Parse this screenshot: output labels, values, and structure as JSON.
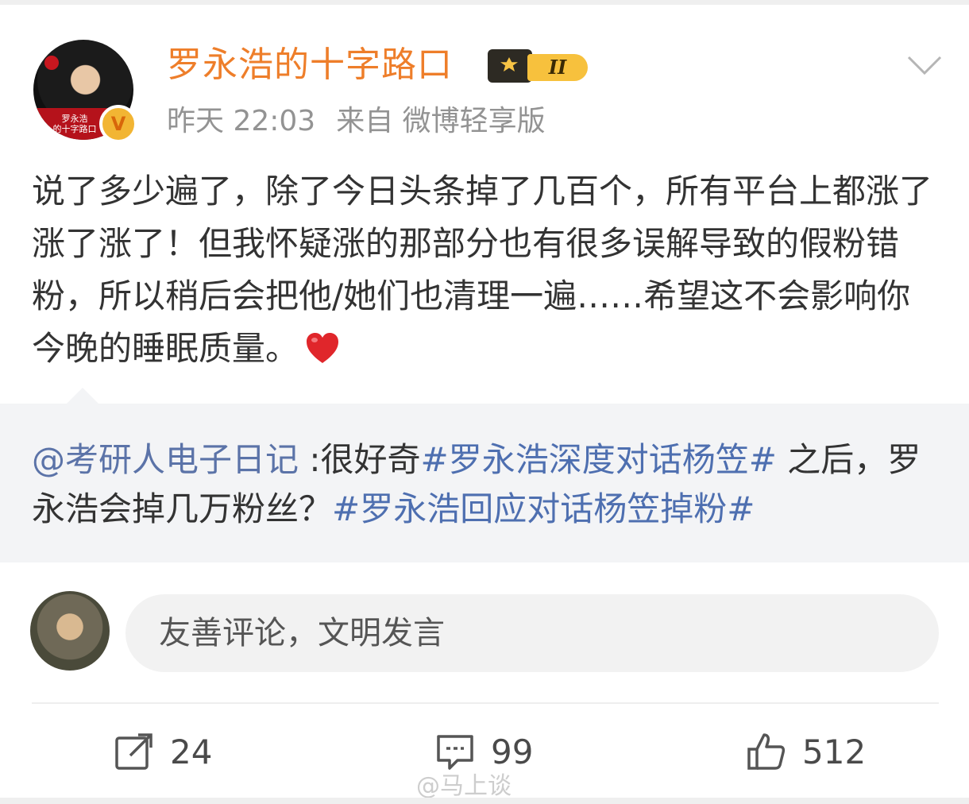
{
  "post": {
    "author": {
      "name": "罗永浩的十字路口",
      "avatar_caption": "罗永浩\n的十字路口",
      "verified_mark": "V",
      "member_level": "II"
    },
    "time": "昨天 22:03",
    "source": "来自 微博轻享版",
    "text": "说了多少遍了，除了今日头条掉了几百个，所有平台上都涨了涨了涨了！但我怀疑涨的那部分也有很多误解导致的假粉错粉，所以稍后会把他/她们也清理一遍……希望这不会影响你今晚的睡眠质量。",
    "quote": {
      "mention": "@考研人电子日记",
      "text_before": " :很好奇",
      "hashtag1": "#罗永浩深度对话杨笠#",
      "text_middle": " 之后，罗永浩会掉几万粉丝？",
      "hashtag2": "#罗永浩回应对话杨笠掉粉#"
    }
  },
  "comment_box": {
    "placeholder": "友善评论，文明发言"
  },
  "actions": {
    "repost_count": "24",
    "comment_count": "99",
    "like_count": "512"
  },
  "watermark": "@马上谈",
  "colors": {
    "username": "#ee7e2a",
    "link": "#4e6fb0",
    "quote_bg": "#f3f4f6",
    "meta": "#939393"
  },
  "icons": [
    "chevron-down-icon",
    "heart-icon",
    "repost-icon",
    "comment-icon",
    "like-icon",
    "verified-icon",
    "member-crown-icon"
  ]
}
